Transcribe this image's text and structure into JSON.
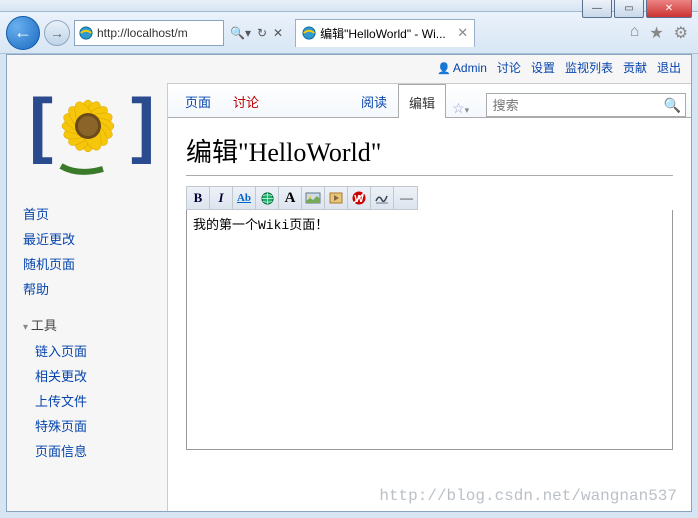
{
  "browser": {
    "url": "http://localhost/m",
    "tab_title": "编辑\"HelloWorld\" - Wi..."
  },
  "personal": {
    "user": "Admin",
    "links": [
      "讨论",
      "设置",
      "监视列表",
      "贡献",
      "退出"
    ]
  },
  "sidebar": {
    "nav": [
      "首页",
      "最近更改",
      "随机页面",
      "帮助"
    ],
    "tools_label": "工具",
    "tools": [
      "链入页面",
      "相关更改",
      "上传文件",
      "特殊页面",
      "页面信息"
    ]
  },
  "tabs": {
    "page": "页面",
    "talk": "讨论",
    "read": "阅读",
    "edit": "编辑"
  },
  "search": {
    "placeholder": "搜索"
  },
  "heading": "编辑\"HelloWorld\"",
  "toolbar": {
    "bold": "B",
    "italic": "I",
    "link": "Ab",
    "ext": "🌐",
    "h2": "A",
    "img": "img",
    "media": "▶",
    "nowiki": "W",
    "sig": "~",
    "hr": "—"
  },
  "editor_text": "我的第一个Wiki页面！",
  "watermark": "http://blog.csdn.net/wangnan537"
}
